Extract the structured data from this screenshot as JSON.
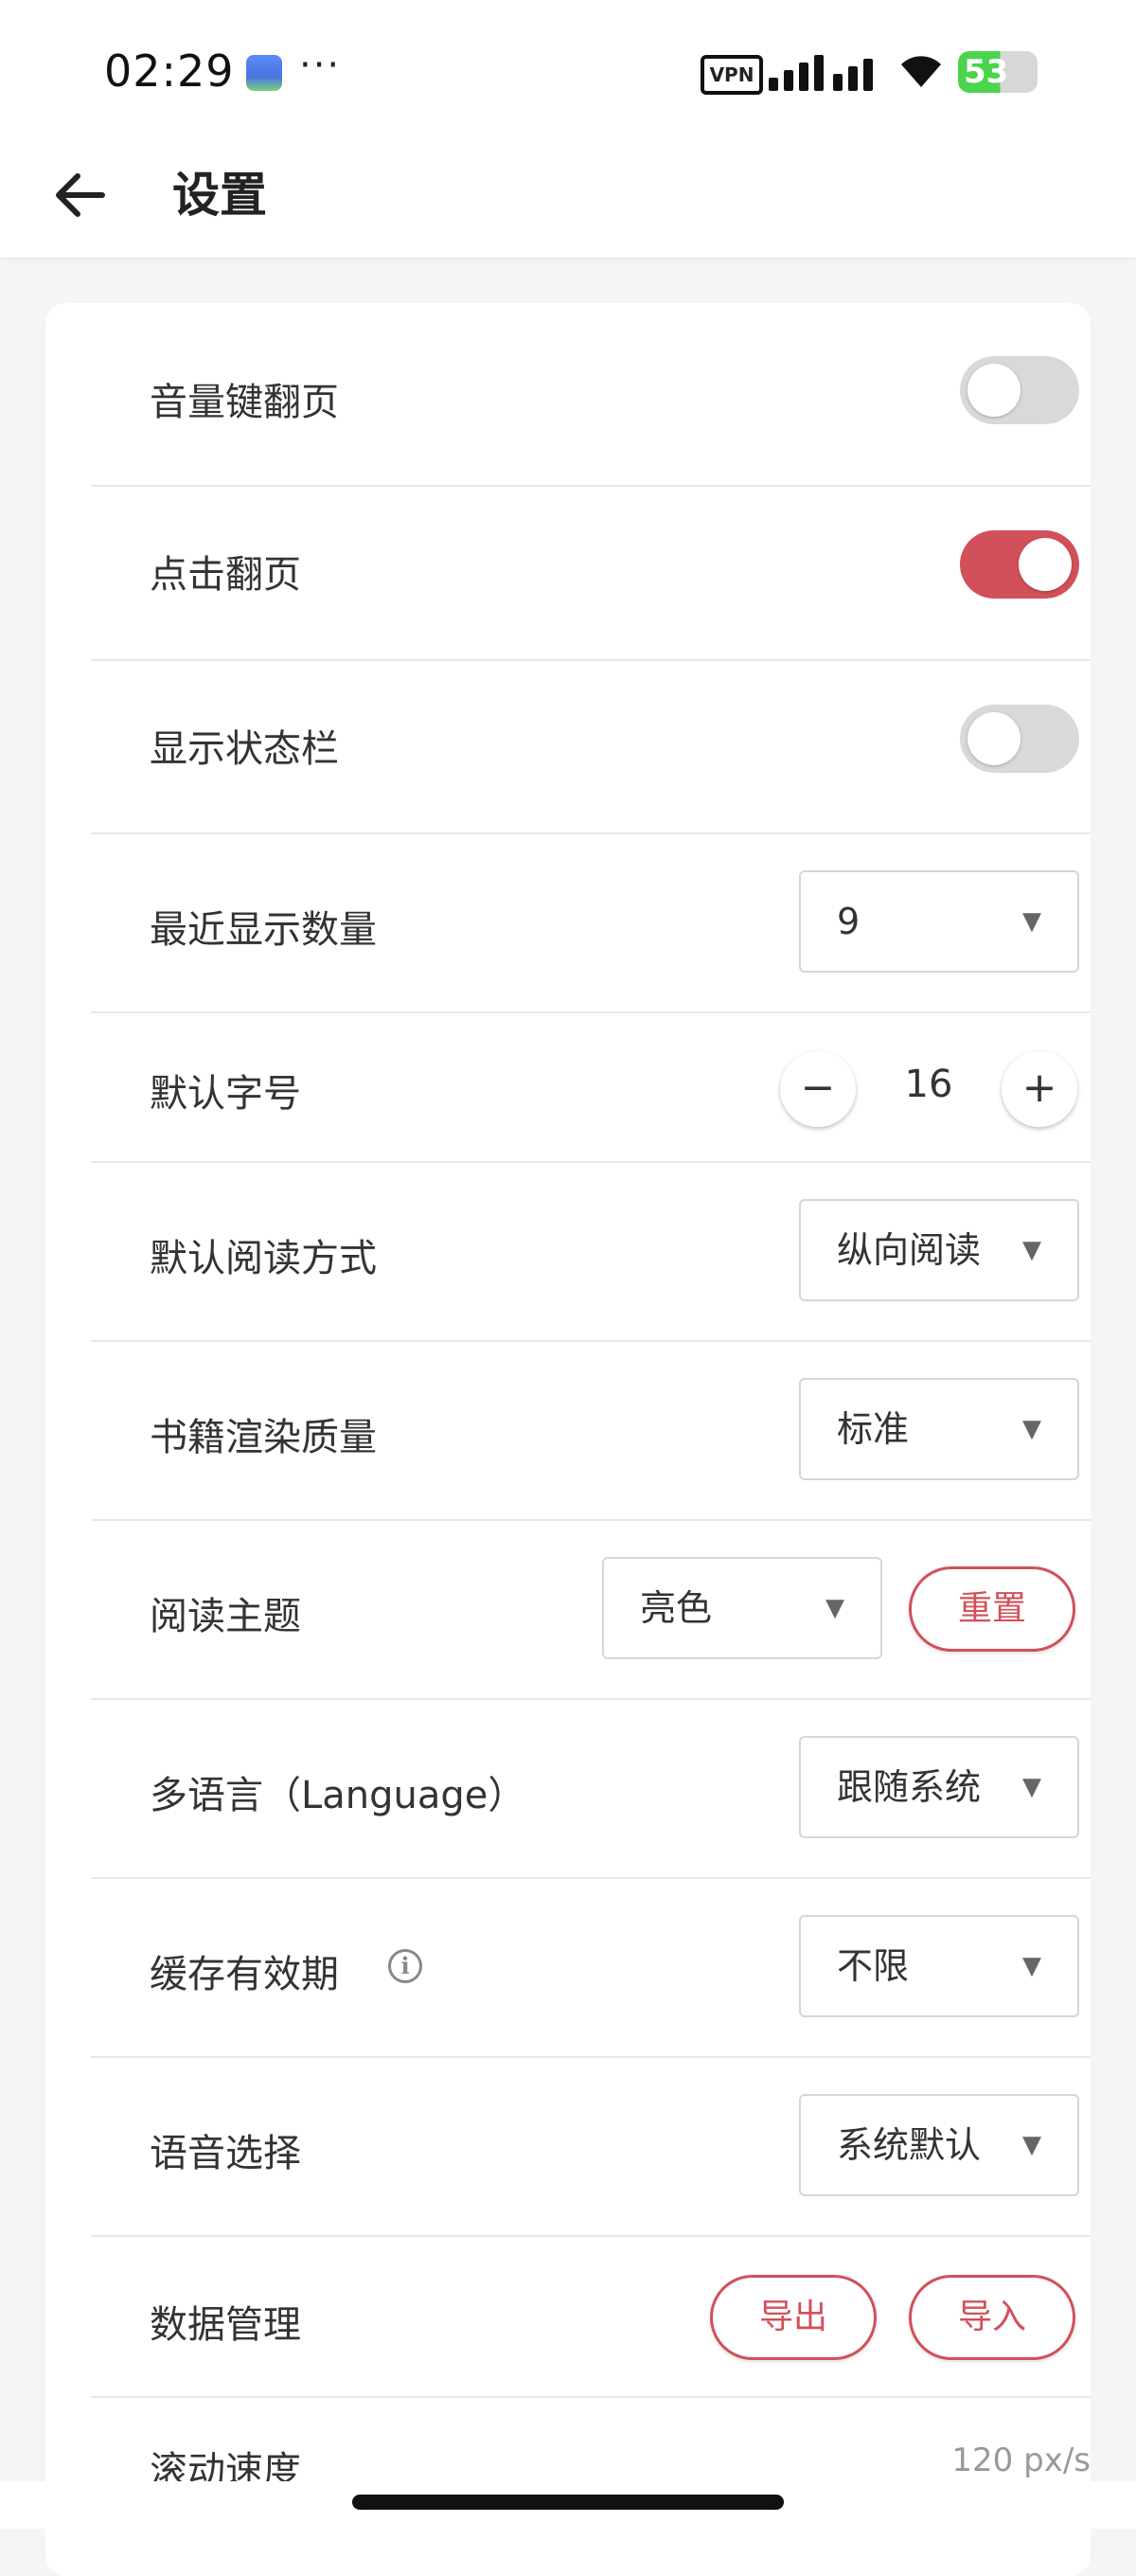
{
  "status_bar": {
    "time": "02:29",
    "more": "···",
    "vpn": "VPN",
    "battery": "53"
  },
  "header": {
    "title": "设置"
  },
  "settings": {
    "volume_key_turn": {
      "label": "音量键翻页",
      "enabled": false
    },
    "tap_turn": {
      "label": "点击翻页",
      "enabled": true
    },
    "show_status_bar": {
      "label": "显示状态栏",
      "enabled": false
    },
    "recent_count": {
      "label": "最近显示数量",
      "value": "9"
    },
    "default_font_size": {
      "label": "默认字号",
      "value": "16",
      "minus": "−",
      "plus": "+"
    },
    "reading_mode": {
      "label": "默认阅读方式",
      "value": "纵向阅读"
    },
    "render_quality": {
      "label": "书籍渲染质量",
      "value": "标准"
    },
    "reading_theme": {
      "label": "阅读主题",
      "value": "亮色",
      "reset_label": "重置"
    },
    "language": {
      "label": "多语言（Language）",
      "value": "跟随系统"
    },
    "cache_validity": {
      "label": "缓存有效期",
      "value": "不限"
    },
    "voice": {
      "label": "语音选择",
      "value": "系统默认"
    },
    "data_management": {
      "label": "数据管理",
      "export_label": "导出",
      "import_label": "导入"
    },
    "scroll_speed": {
      "label": "滚动速度",
      "value": "120 px/s"
    }
  },
  "colors": {
    "accent": "#d2505a",
    "toggle_off": "#d9d9d9",
    "background": "#f5f5f5"
  },
  "icons": {
    "back": "arrow-left-icon",
    "info": "info-icon",
    "dropdown": "triangle-down-icon"
  }
}
